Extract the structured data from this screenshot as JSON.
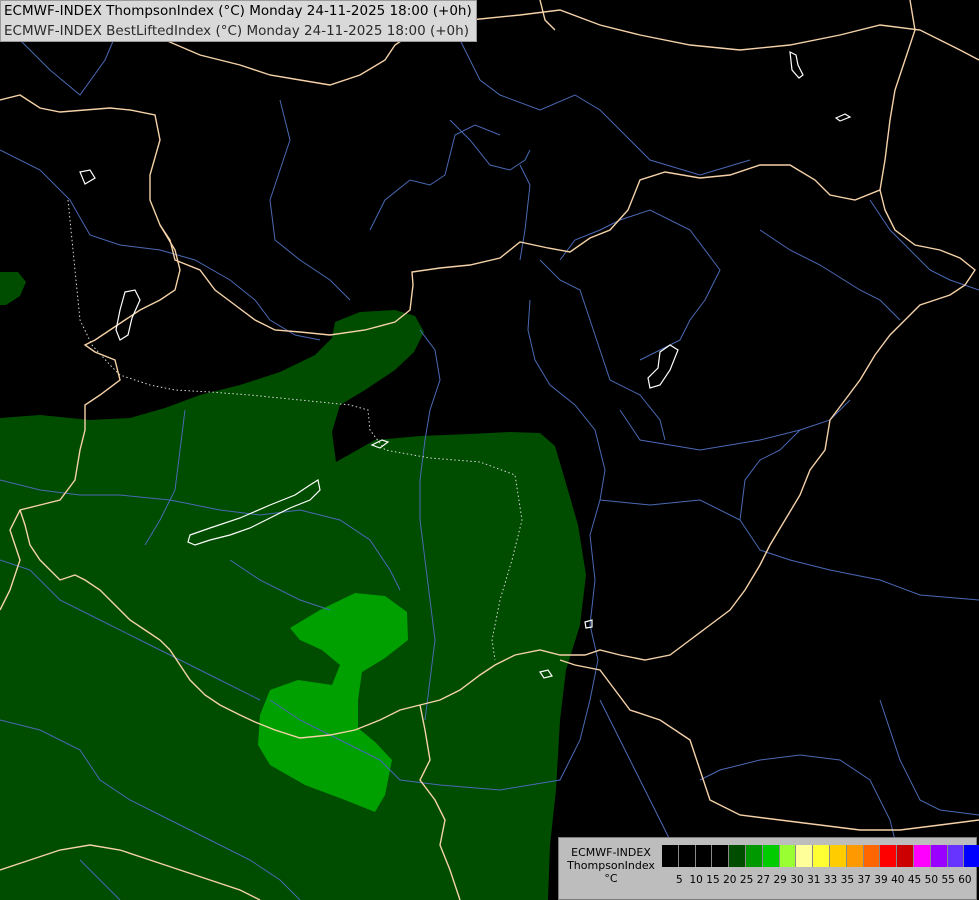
{
  "header": {
    "line1": "ECMWF-INDEX ThompsonIndex (°C) Monday 24-11-2025 18:00 (+0h)",
    "line2": "ECMWF-INDEX BestLiftedIndex (°C) Monday 24-11-2025 18:00 (+0h)"
  },
  "legend": {
    "caption1": "ECMWF-INDEX",
    "caption2": "ThompsonIndex",
    "caption3": "°C",
    "ticks": [
      "5",
      "10",
      "15",
      "20",
      "25",
      "27",
      "29",
      "30",
      "31",
      "33",
      "35",
      "37",
      "39",
      "40",
      "45",
      "50",
      "55",
      "60"
    ],
    "colors": [
      "#000000",
      "#000000",
      "#000000",
      "#000000",
      "#004d00",
      "#009900",
      "#00cc00",
      "#99ff33",
      "#ffff99",
      "#ffff33",
      "#ffcc00",
      "#ff9900",
      "#ff6600",
      "#ff0000",
      "#cc0000",
      "#ff00ff",
      "#9900ff",
      "#6633ff",
      "#0000ff"
    ]
  },
  "map_colors": {
    "background": "#000000",
    "index_25": "#004d00",
    "index_27": "#00a000",
    "borders": "#f5d2a8",
    "rivers": "#4a69b5",
    "lakes": "#ffffff",
    "regions": "#cfcfcf"
  }
}
